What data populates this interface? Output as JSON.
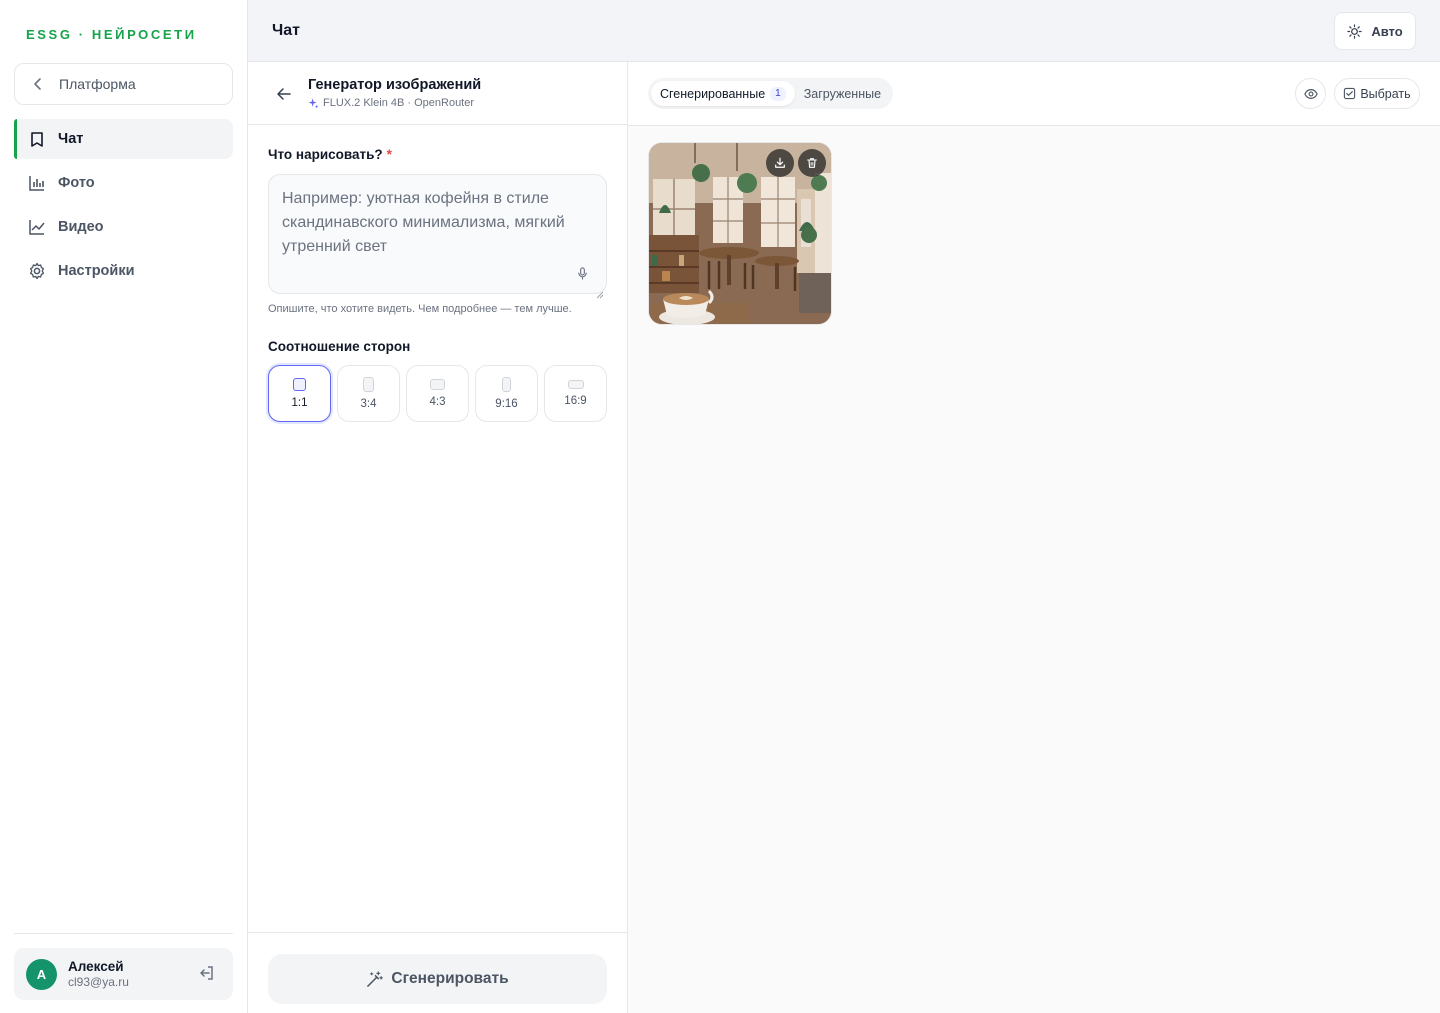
{
  "sidebar": {
    "logo": "ESSG · НЕЙРОСЕТИ",
    "back_label": "Платформа",
    "items": [
      {
        "label": "Чат",
        "icon": "book-icon",
        "active": true
      },
      {
        "label": "Фото",
        "icon": "bar-chart-icon",
        "active": false
      },
      {
        "label": "Видео",
        "icon": "line-chart-icon",
        "active": false
      },
      {
        "label": "Настройки",
        "icon": "gear-icon",
        "active": false
      }
    ],
    "user": {
      "initial": "A",
      "name": "Алексей",
      "email": "cl93@ya.ru"
    }
  },
  "topbar": {
    "title": "Чат",
    "theme_label": "Авто"
  },
  "tool": {
    "title": "Генератор изображений",
    "model": "FLUX.2 Klein 4B · OpenRouter",
    "prompt_label": "Что нарисовать?",
    "required_mark": "*",
    "prompt_placeholder": "Например: уютная кофейня в стиле скандинавского минимализма, мягкий утренний свет",
    "prompt_value": "",
    "helper": "Опишите, что хотите видеть. Чем подробнее — тем лучше.",
    "ratio_label": "Соотношение сторон",
    "ratios": [
      "1:1",
      "3:4",
      "4:3",
      "9:16",
      "16:9"
    ],
    "selected_ratio": "1:1",
    "generate_label": "Сгенерировать"
  },
  "gallery": {
    "tabs": [
      {
        "label": "Сгенерированные",
        "count": "1",
        "active": true
      },
      {
        "label": "Загруженные",
        "active": false
      }
    ],
    "select_label": "Выбрать",
    "images": [
      {
        "subject": "cozy-cafe-interior"
      }
    ]
  }
}
